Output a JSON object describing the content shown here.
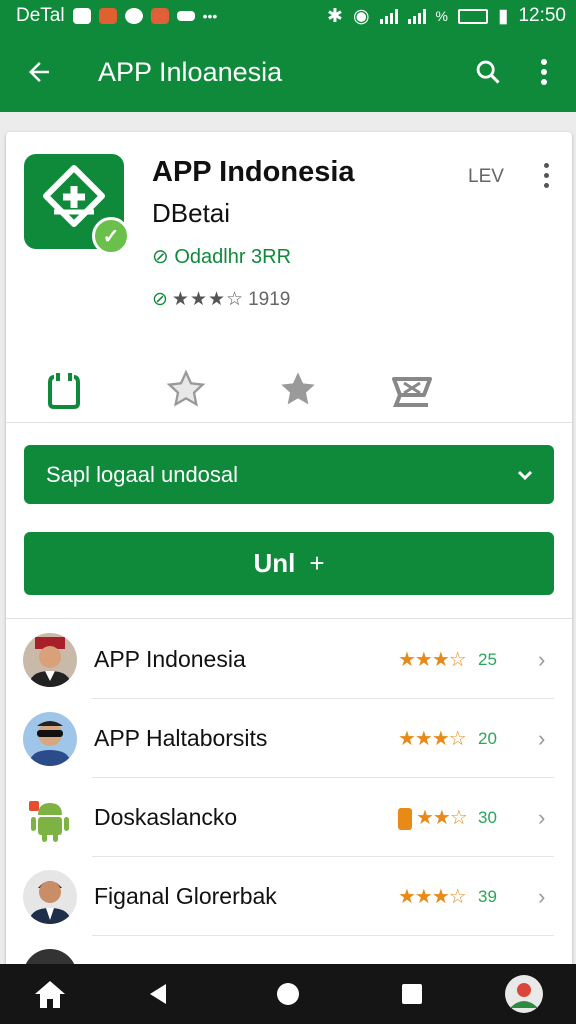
{
  "status_bar": {
    "carrier": "DeTal",
    "more": "•••",
    "percent": "%",
    "time": "12:50"
  },
  "app_bar": {
    "back_icon": "arrow-back-icon",
    "title": "APP Inloanesia",
    "search_icon": "search-icon",
    "more_icon": "more-vertical-icon"
  },
  "app": {
    "name": "APP Indonesia",
    "subtitle": "DBetai",
    "lev": "LEV",
    "developer": "Odadlhr 3RR",
    "rating_stars": "★★★☆",
    "rating_count": "1919"
  },
  "actions": [
    {
      "icon": "share-icon"
    },
    {
      "icon": "star-outline-icon"
    },
    {
      "icon": "star-icon"
    },
    {
      "icon": "cart-icon"
    }
  ],
  "dropdown": {
    "label": "Sapl logaal undosal",
    "chevron_icon": "chevron-down-icon"
  },
  "install": {
    "label": "Unl",
    "plus": "+"
  },
  "list": [
    {
      "name": "APP Indonesia",
      "stars": "★★★☆",
      "value": "25",
      "avatar": "person-avatar"
    },
    {
      "name": "APP Haltaborsits",
      "stars": "★★★☆",
      "value": "20",
      "avatar": "person-glasses-avatar"
    },
    {
      "name": "Doskaslancko",
      "stars": "★★☆",
      "value": "30",
      "avatar": "android-avatar"
    },
    {
      "name": "Figanal Glorerbak",
      "stars": "★★★☆",
      "value": "39",
      "avatar": "person-suit-avatar"
    }
  ],
  "nav": {
    "home_icon": "home-icon",
    "back_icon": "triangle-back-icon",
    "home_circle_icon": "circle-home-icon",
    "recents_icon": "square-recents-icon",
    "profile_icon": "profile-avatar-icon"
  },
  "colors": {
    "primary": "#0f8a3b",
    "accent_star": "#e88a17",
    "rating_value": "#2aa65a"
  }
}
